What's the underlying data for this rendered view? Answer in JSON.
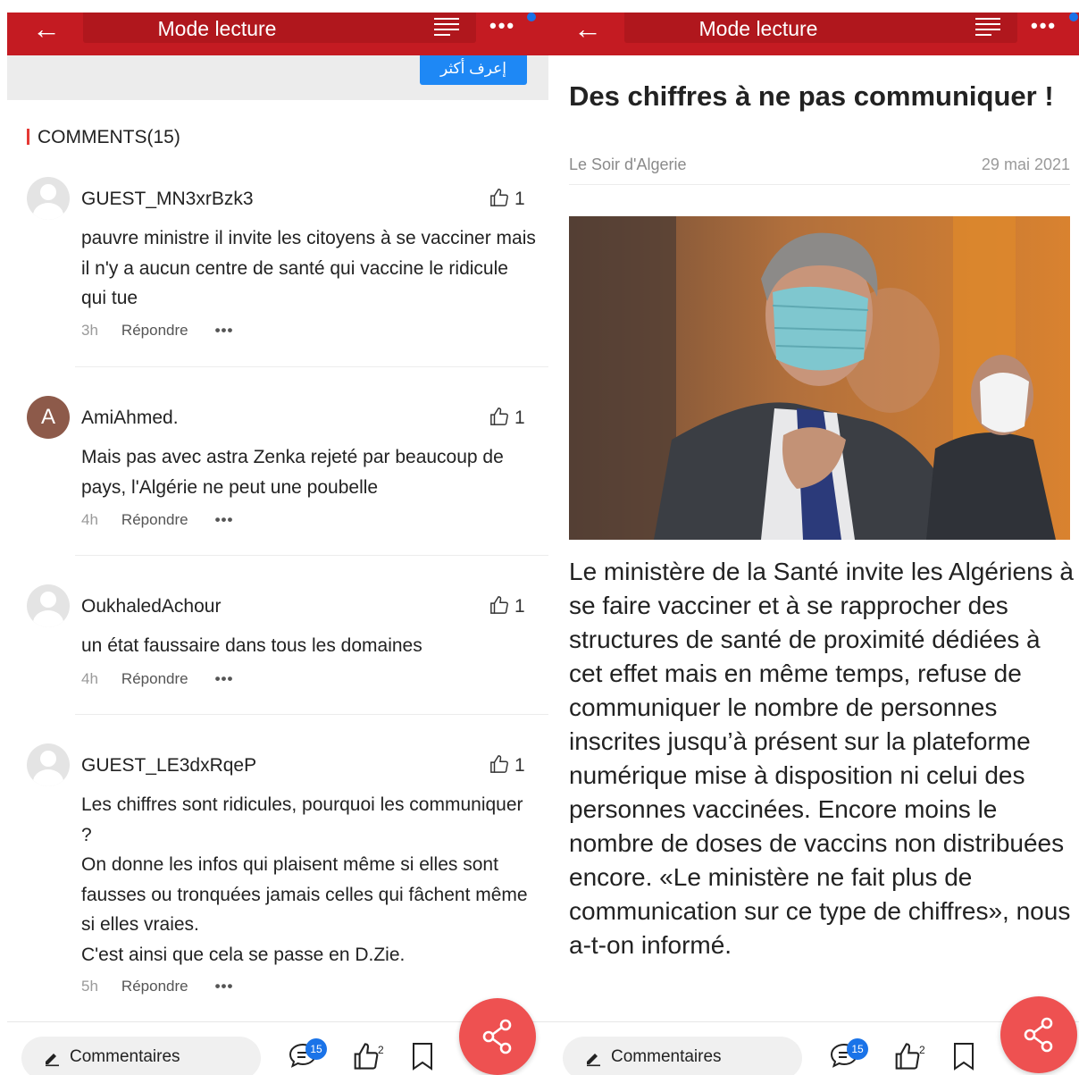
{
  "topbar": {
    "title": "Mode lecture"
  },
  "left": {
    "ad_button": "إعرف أكثر",
    "comments_header": "COMMENTS(15)",
    "reply_label": "Répondre",
    "more_label": "•••",
    "comments": [
      {
        "name": "GUEST_MN3xrBzk3",
        "likes": "1",
        "text": "pauvre  ministre il invite les citoyens à se vacciner mais il n'y a aucun centre de santé  qui vaccine le ridicule qui tue",
        "time": "3h"
      },
      {
        "name": "AmiAhmed.",
        "avatar_letter": "A",
        "likes": "1",
        "text": "Mais pas avec astra Zenka rejeté par beaucoup de pays, l'Algérie ne peut une poubelle",
        "time": "4h"
      },
      {
        "name": "OukhaledAchour",
        "likes": "1",
        "text": "un état faussaire dans tous les domaines",
        "time": "4h"
      },
      {
        "name": "GUEST_LE3dxRqeP",
        "likes": "1",
        "text_lines": [
          "Les chiffres sont ridicules, pourquoi les communiquer ?",
          "On donne les infos qui plaisent même si elles sont fausses ou tronquées jamais celles qui fâchent même si elles vraies.",
          "C'est ainsi que cela se passe en D.Zie."
        ],
        "time": "5h"
      }
    ]
  },
  "right": {
    "article_title": "Des chiffres à ne pas communiquer !",
    "source": "Le Soir d'Algerie",
    "date": "29 mai 2021",
    "body": "Le ministère de la Santé invite les Algériens à se faire vacciner et à se rapprocher des structures de santé de proximité dédiées à cet effet mais en même temps, refuse de communiquer le nombre de personnes inscrites jusqu’à présent sur la plateforme numérique mise à disposition ni celui des personnes vaccinées. Encore moins le nombre de doses de vaccins non distribuées encore. «Le ministère ne fait plus de communication sur ce type de chiffres», nous a-t-on informé."
  },
  "bottombar": {
    "comment_button": "Commentaires",
    "comment_count": "15",
    "like_count": "2"
  },
  "colors": {
    "brand_red": "#c41b22",
    "fab": "#ee5151",
    "badge_blue": "#1a73e8",
    "ad_blue": "#1e88f5"
  },
  "icons": [
    "back-arrow-icon",
    "text-menu-icon",
    "more-dots-icon",
    "thumbs-up-icon",
    "pencil-icon",
    "comment-bubble-icon",
    "bookmark-icon",
    "share-icon",
    "avatar-placeholder-icon"
  ]
}
